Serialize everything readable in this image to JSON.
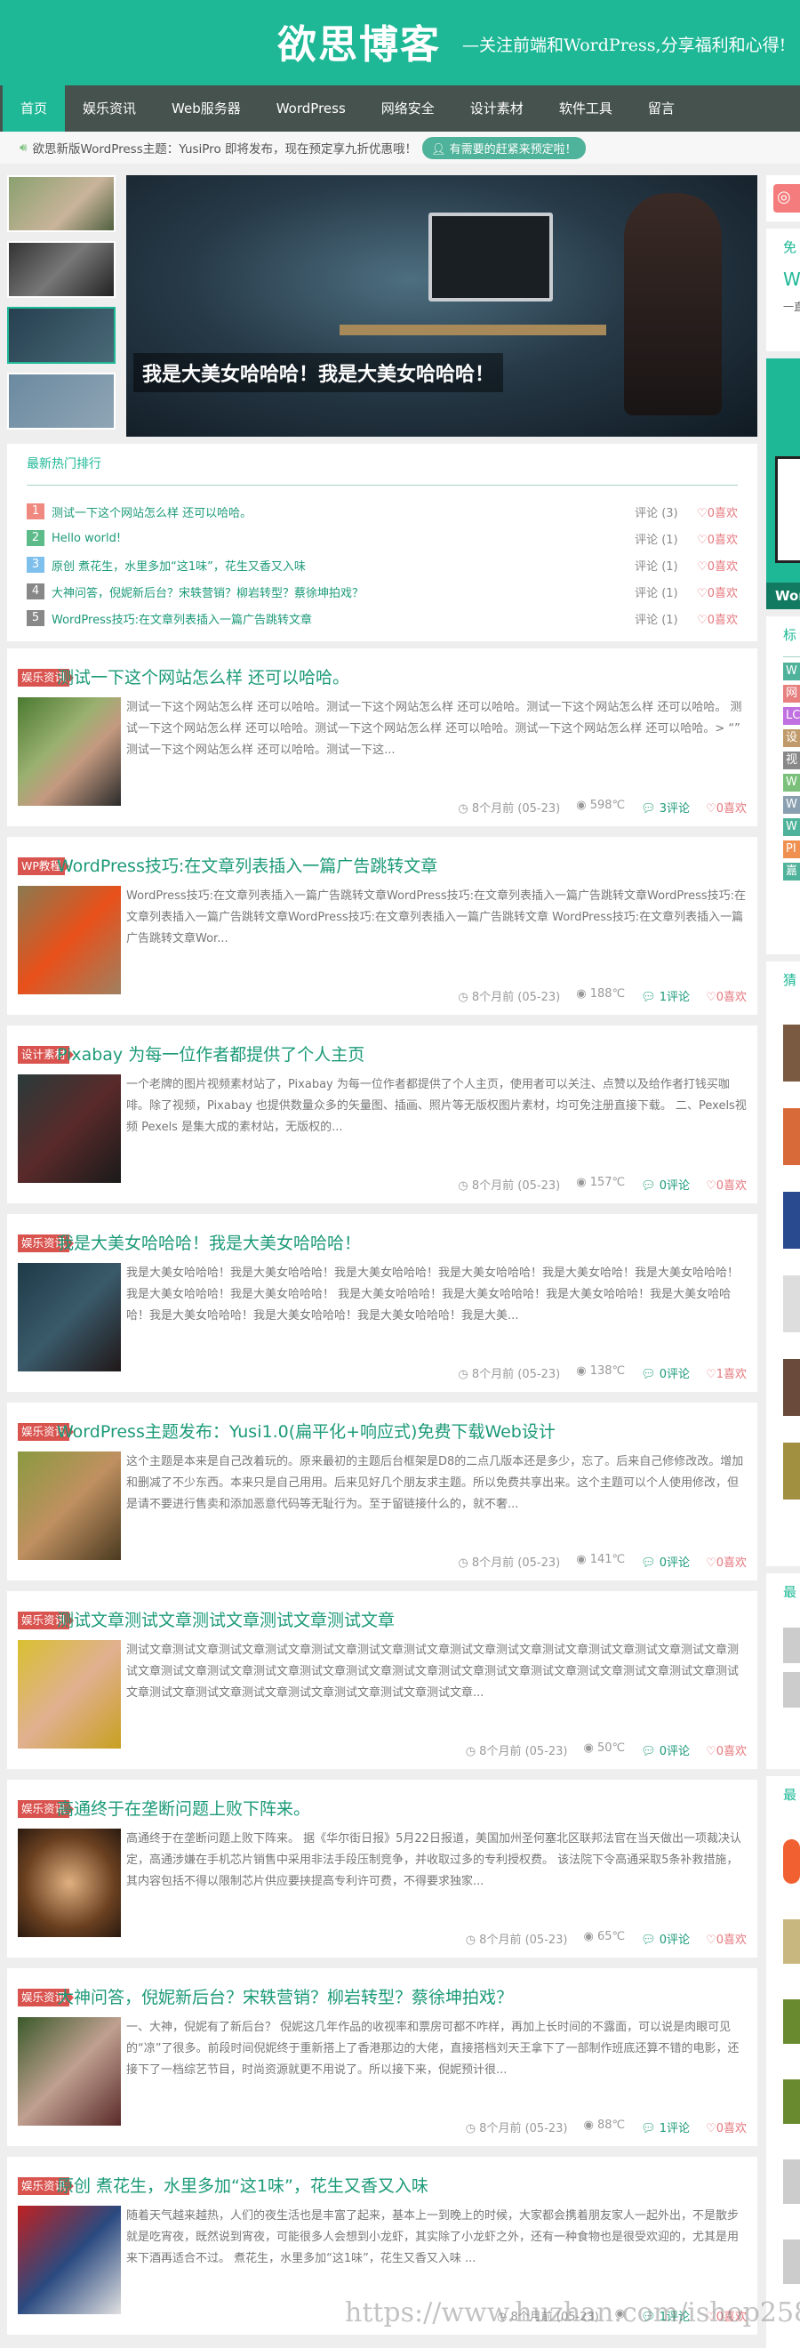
{
  "site": {
    "logo": "欲思博客",
    "slogan": "—关注前端和WordPress,分享福利和心得!"
  },
  "nav": [
    "首页",
    "娱乐资讯",
    "Web服务器",
    "WordPress",
    "网络安全",
    "设计素材",
    "软件工具",
    "留言"
  ],
  "notice": {
    "text": "欲思新版WordPress主题：YusiPro 即将发布，现在预定享九折优惠哦！",
    "button": "有需要的赶紧来预定啦！"
  },
  "slider": {
    "caption": "我是大美女哈哈哈！我是大美女哈哈哈！"
  },
  "hot": {
    "title": "最新热门排行",
    "items": [
      {
        "n": "1",
        "title": "测试一下这个网站怎么样 还可以哈哈。",
        "comments": "评论 (3)",
        "likes": "♡0喜欢",
        "color": "#f08a80"
      },
      {
        "n": "2",
        "title": "Hello world!",
        "comments": "评论 (1)",
        "likes": "♡0喜欢",
        "color": "#5dbb8a"
      },
      {
        "n": "3",
        "title": "原创 煮花生，水里多加“这1味”，花生又香又入味",
        "comments": "评论 (1)",
        "likes": "♡0喜欢",
        "color": "#7fbfec"
      },
      {
        "n": "4",
        "title": "大神问答，倪妮新后台？宋轶营销？柳岩转型？蔡徐坤拍戏？",
        "comments": "评论 (1)",
        "likes": "♡0喜欢",
        "color": "#888888"
      },
      {
        "n": "5",
        "title": "WordPress技巧:在文章列表插入一篇广告跳转文章",
        "comments": "评论 (1)",
        "likes": "♡0喜欢",
        "color": "#888888"
      }
    ]
  },
  "posts": [
    {
      "cat": "娱乐资讯",
      "title": "测试一下这个网站怎么样 还可以哈哈。",
      "excerpt": "测试一下这个网站怎么样 还可以哈哈。测试一下这个网站怎么样 还可以哈哈。测试一下这个网站怎么样 还可以哈哈。 测试一下这个网站怎么样 还可以哈哈。测试一下这个网站怎么样 还可以哈哈。测试一下这个网站怎么样 还可以哈哈。> “” 测试一下这个网站怎么样 还可以哈哈。测试一下这...",
      "time": "8个月前 (05-23)",
      "views": "598℃",
      "comments": "3评论",
      "likes": "♡0喜欢"
    },
    {
      "cat": "WP教程",
      "title": "WordPress技巧:在文章列表插入一篇广告跳转文章",
      "excerpt": "WordPress技巧:在文章列表插入一篇广告跳转文章WordPress技巧:在文章列表插入一篇广告跳转文章WordPress技巧:在文章列表插入一篇广告跳转文章WordPress技巧:在文章列表插入一篇广告跳转文章 WordPress技巧:在文章列表插入一篇广告跳转文章Wor...",
      "time": "8个月前 (05-23)",
      "views": "188℃",
      "comments": "1评论",
      "likes": "♡0喜欢"
    },
    {
      "cat": "设计素材",
      "title": "Pixabay 为每一位作者都提供了个人主页",
      "excerpt": "一个老牌的图片视频素材站了，Pixabay 为每一位作者都提供了个人主页，使用者可以关注、点赞以及给作者打钱买咖啡。除了视频，Pixabay 也提供数量众多的矢量图、插画、照片等无版权图片素材，均可免注册直接下载。 二、Pexels视频 Pexels 是集大成的素材站，无版权的...",
      "time": "8个月前 (05-23)",
      "views": "157℃",
      "comments": "0评论",
      "likes": "♡0喜欢"
    },
    {
      "cat": "娱乐资讯",
      "title": "我是大美女哈哈哈！我是大美女哈哈哈！",
      "excerpt": "我是大美女哈哈哈！我是大美女哈哈哈！我是大美女哈哈哈！我是大美女哈哈哈！我是大美女哈哈！我是大美女哈哈哈！我是大美女哈哈哈！我是大美女哈哈哈！ 我是大美女哈哈哈！我是大美女哈哈哈！我是大美女哈哈哈！我是大美女哈哈哈！我是大美女哈哈哈！我是大美女哈哈哈！我是大美女哈哈哈！我是大美...",
      "time": "8个月前 (05-23)",
      "views": "138℃",
      "comments": "0评论",
      "likes": "♡1喜欢"
    },
    {
      "cat": "娱乐资讯",
      "title": "WordPress主题发布：Yusi1.0(扁平化+响应式)免费下载Web设计",
      "excerpt": "这个主题是本来是自己改着玩的。原来最初的主题后台框架是D8的二点几版本还是多少，忘了。后来自己修修改改。增加和删减了不少东西。本来只是自己用用。后来见好几个朋友求主题。所以免费共享出来。这个主题可以个人使用修改，但是请不要进行售卖和添加恶意代码等无耻行为。至于留链接什么的，就不奢...",
      "time": "8个月前 (05-23)",
      "views": "141℃",
      "comments": "0评论",
      "likes": "♡0喜欢"
    },
    {
      "cat": "娱乐资讯",
      "title": "测试文章测试文章测试文章测试文章测试文章",
      "excerpt": "测试文章测试文章测试文章测试文章测试文章测试文章测试文章测试文章测试文章测试文章测试文章测试文章测试文章测试文章测试文章测试文章测试文章测试文章测试文章测试文章测试文章测试文章测试文章测试文章测试文章测试文章测试文章测试文章测试文章测试文章测试文章测试文章测试文章测试文章...",
      "time": "8个月前 (05-23)",
      "views": "50℃",
      "comments": "0评论",
      "likes": "♡0喜欢"
    },
    {
      "cat": "娱乐资讯",
      "title": "高通终于在垄断问题上败下阵来。",
      "excerpt": "高通终于在垄断问题上败下阵来。 据《华尔街日报》5月22日报道，美国加州圣何塞北区联邦法官在当天做出一项裁决认定，高通涉嫌在手机芯片销售中采用非法手段压制竞争，并收取过多的专利授权费。 该法院下令高通采取5条补救措施，其内容包括不得以限制芯片供应要挟提高专利许可费，不得要求独家...",
      "time": "8个月前 (05-23)",
      "views": "65℃",
      "comments": "0评论",
      "likes": "♡0喜欢"
    },
    {
      "cat": "娱乐资讯",
      "title": "大神问答，倪妮新后台？宋轶营销？柳岩转型？蔡徐坤拍戏？",
      "excerpt": "一、大神，倪妮有了新后台？ 倪妮这几年作品的收视率和票房可都不咋样，再加上长时间的不露面，可以说是肉眼可见的“凉”了很多。前段时间倪妮终于重新搭上了香港那边的大佬，直接搭档刘天王拿下了一部制作班底还算不错的电影，还接下了一档综艺节目，时尚资源就更不用说了。所以接下来，倪妮预计很...",
      "time": "8个月前 (05-23)",
      "views": "88℃",
      "comments": "1评论",
      "likes": "♡0喜欢"
    },
    {
      "cat": "娱乐资讯",
      "title": "原创 煮花生，水里多加“这1味”，花生又香又入味",
      "excerpt": "随着天气越来越热，人们的夜生活也是丰富了起来，基本上一到晚上的时候，大家都会携着朋友家人一起外出，不是散步就是吃宵夜，既然说到宵夜，可能很多人会想到小龙虾，其实除了小龙虾之外，还有一种食物也是很受欢迎的，尤其是用来下酒再适合不过。 煮花生，水里多加“这1味”，花生又香又入味 ...",
      "time": "8个月前 (05-23)",
      "views": "",
      "comments": "1评论",
      "likes": "♡0喜欢"
    }
  ],
  "sidebar": {
    "free_title": "免",
    "free_sub": "W",
    "free_text": "一直",
    "banner_label": "Wor",
    "tags_title": "标",
    "tags": [
      "W",
      "网",
      "LC",
      "设",
      "视",
      "W",
      "W",
      "W",
      "PI",
      "嘉"
    ],
    "guess_title": "猜",
    "latest_title": "最",
    "latest2_title": "最"
  },
  "watermark": "https://www.huzhan.com/ishop25883"
}
